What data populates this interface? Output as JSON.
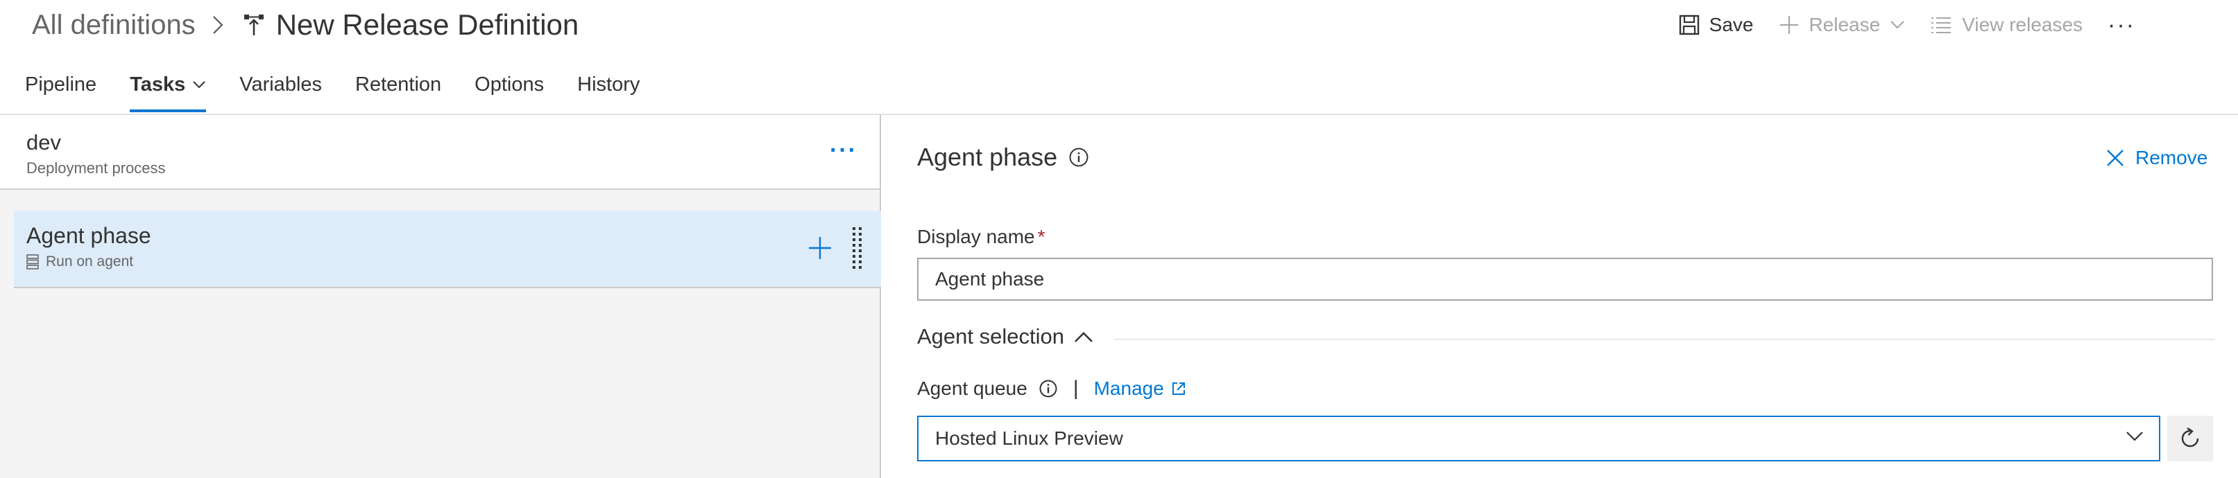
{
  "header": {
    "breadcrumb_root": "All definitions",
    "breadcrumb_separator_icon": "chevron-right-icon",
    "definition_icon": "release-pipeline-icon",
    "title": "New Release Definition"
  },
  "toolbar": {
    "save_label": "Save",
    "release_label": "Release",
    "view_releases_label": "View releases",
    "more_label": "···"
  },
  "tabs": [
    {
      "label": "Pipeline",
      "active": false
    },
    {
      "label": "Tasks",
      "active": true,
      "has_dropdown": true
    },
    {
      "label": "Variables",
      "active": false
    },
    {
      "label": "Retention",
      "active": false
    },
    {
      "label": "Options",
      "active": false
    },
    {
      "label": "History",
      "active": false
    }
  ],
  "left_pane": {
    "environment_name": "dev",
    "environment_subtitle": "Deployment process",
    "environment_more": "···",
    "phase": {
      "title": "Agent phase",
      "subtitle": "Run on agent"
    }
  },
  "right_pane": {
    "title": "Agent phase",
    "remove_label": "Remove",
    "display_name_label": "Display name",
    "required_marker": "*",
    "display_name_value": "Agent phase",
    "agent_selection_label": "Agent selection",
    "agent_queue_label": "Agent queue",
    "separator": "|",
    "manage_label": "Manage",
    "agent_queue_value": "Hosted Linux Preview"
  },
  "colors": {
    "accent": "#0078d4",
    "selected_row": "#deecf9",
    "left_background": "#f4f4f4",
    "required": "#a4262c",
    "disabled_text": "#a6a6a6"
  }
}
